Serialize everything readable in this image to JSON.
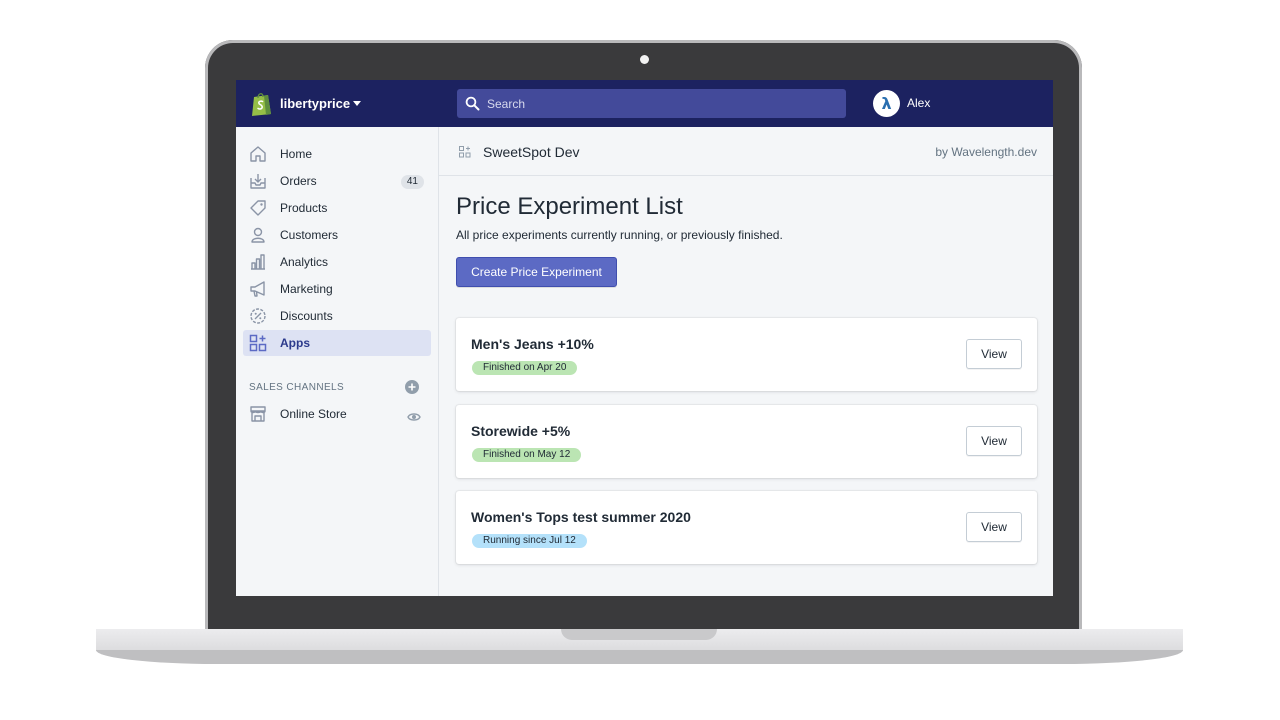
{
  "topbar": {
    "store_name": "libertyprice",
    "search_placeholder": "Search",
    "avatar_glyph": "λ",
    "user_name": "Alex"
  },
  "sidebar": {
    "items": [
      {
        "label": "Home",
        "icon": "home-icon"
      },
      {
        "label": "Orders",
        "icon": "orders-icon",
        "badge": "41"
      },
      {
        "label": "Products",
        "icon": "tag-icon"
      },
      {
        "label": "Customers",
        "icon": "person-icon"
      },
      {
        "label": "Analytics",
        "icon": "bar-chart-icon"
      },
      {
        "label": "Marketing",
        "icon": "megaphone-icon"
      },
      {
        "label": "Discounts",
        "icon": "discount-icon"
      },
      {
        "label": "Apps",
        "icon": "apps-icon",
        "active": true
      }
    ],
    "sales_channels_header": "SALES CHANNELS",
    "channels": [
      {
        "label": "Online Store",
        "icon": "store-icon"
      }
    ]
  },
  "app_header": {
    "title": "SweetSpot Dev",
    "byline": "by Wavelength.dev"
  },
  "page": {
    "title": "Price Experiment List",
    "subtitle": "All price experiments currently running, or previously finished.",
    "create_button": "Create Price Experiment"
  },
  "experiments": [
    {
      "name": "Men's Jeans +10%",
      "status": "Finished on Apr 20",
      "status_color": "#bbe5b3",
      "action": "View"
    },
    {
      "name": "Storewide +5%",
      "status": "Finished on May 12",
      "status_color": "#bbe5b3",
      "action": "View"
    },
    {
      "name": "Women's Tops test summer 2020",
      "status": "Running since Jul 12",
      "status_color": "#b4e1fa",
      "action": "View"
    }
  ],
  "colors": {
    "topbar": "#1c2260",
    "primary": "#5c6ac4",
    "shopify_green": "#95bf47"
  }
}
